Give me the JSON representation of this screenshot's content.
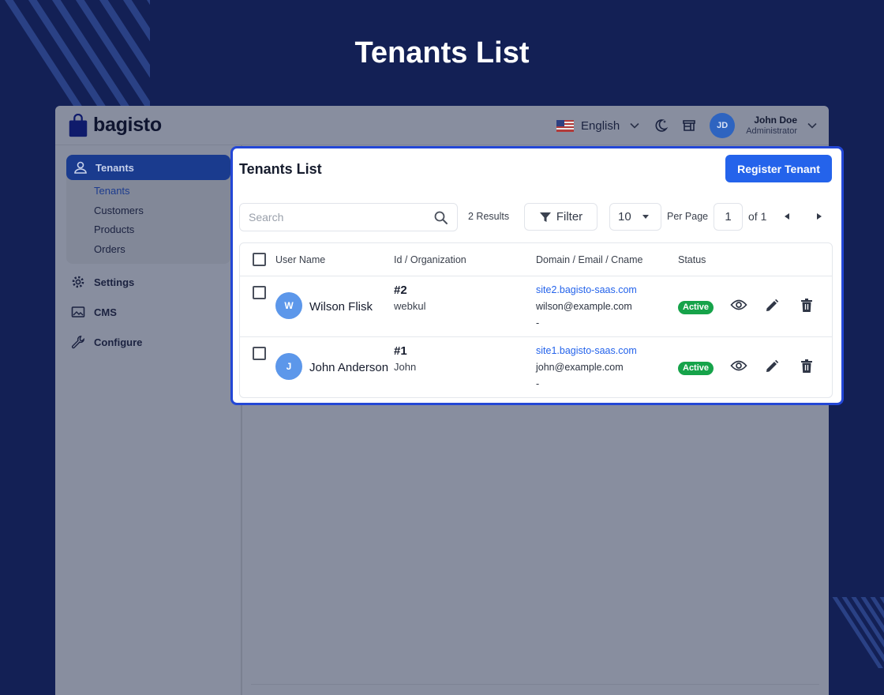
{
  "hero": {
    "title": "Tenants List"
  },
  "brand": {
    "name": "bagisto"
  },
  "header": {
    "language": "English",
    "user_initials": "JD",
    "user_name": "John Doe",
    "user_role": "Administrator"
  },
  "sidebar": {
    "active_section": "Tenants",
    "sub_items": [
      "Tenants",
      "Customers",
      "Products",
      "Orders"
    ],
    "items": [
      "Settings",
      "CMS",
      "Configure"
    ]
  },
  "page": {
    "title": "Tenants List",
    "register_label": "Register Tenant",
    "search_placeholder": "Search",
    "results": "2 Results",
    "filter_label": "Filter",
    "per_page_value": "10",
    "per_page_label": "Per Page",
    "current_page": "1",
    "of_pages": "of 1"
  },
  "table": {
    "columns": [
      "User Name",
      "Id / Organization",
      "Domain / Email / Cname",
      "Status"
    ],
    "rows": [
      {
        "initial": "W",
        "name": "Wilson Flisk",
        "id": "#2",
        "organization": "webkul",
        "domain": "site2.bagisto-saas.com",
        "email": "wilson@example.com",
        "cname": "-",
        "status": "Active"
      },
      {
        "initial": "J",
        "name": "John Anderson",
        "id": "#1",
        "organization": "John",
        "domain": "site1.bagisto-saas.com",
        "email": "john@example.com",
        "cname": "-",
        "status": "Active"
      }
    ]
  },
  "colors": {
    "background": "#132055",
    "primary": "#2463eb",
    "highlight_border": "#2347d6",
    "active_badge": "#16a34a",
    "avatar": "#5c97ea"
  }
}
